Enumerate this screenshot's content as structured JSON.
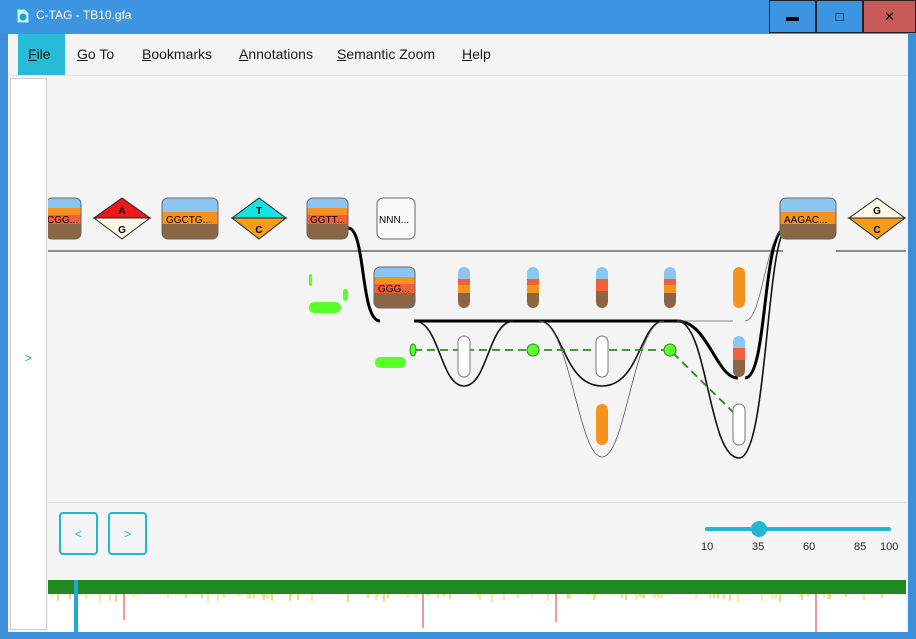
{
  "window": {
    "title": "C-TAG - TB10.gfa",
    "minimize_glyph": "▬",
    "maximize_glyph": "□",
    "close_glyph": "✕"
  },
  "menu": [
    {
      "label": "File",
      "key": "F",
      "rest": "ile",
      "active": true
    },
    {
      "label": "Go To",
      "key": "G",
      "rest": "o To",
      "active": false
    },
    {
      "label": "Bookmarks",
      "key": "B",
      "rest": "ookmarks",
      "active": false
    },
    {
      "label": "Annotations",
      "key": "A",
      "rest": "nnotations",
      "active": false
    },
    {
      "label": "Semantic Zoom",
      "key": "S",
      "rest": "emantic Zoom",
      "active": false
    },
    {
      "label": "Help",
      "key": "H",
      "rest": "elp",
      "active": false
    }
  ],
  "sidebar": {
    "toggle_label": ">"
  },
  "graph": {
    "nodes": [
      {
        "id": "n0",
        "label": "CGG..."
      },
      {
        "id": "n1",
        "label": "GGCTG..."
      },
      {
        "id": "n2",
        "label": "GGTT..."
      },
      {
        "id": "n3",
        "label": "NNN..."
      },
      {
        "id": "n4",
        "label": "GGG..."
      },
      {
        "id": "n5",
        "label": "AAGAC..."
      }
    ],
    "snps": [
      {
        "id": "s0",
        "top": "A",
        "bottom": "G",
        "top_color": "#e81b1b",
        "bottom_color": "#fbf6e8"
      },
      {
        "id": "s1",
        "top": "T",
        "bottom": "C",
        "top_color": "#17e3e3",
        "bottom_color": "#f49d1c"
      },
      {
        "id": "s2",
        "top": "G",
        "bottom": "C",
        "top_color": "#fdf8e9",
        "bottom_color": "#f49d1c"
      }
    ],
    "colors": {
      "blue_band": "#8cc6f0",
      "orange_band": "#f5931e",
      "red_band": "#f0603a",
      "brown_band": "#8b6645",
      "annotation_green": "#5bff2a",
      "path_green": "#2f8a1e"
    }
  },
  "navigation": {
    "prev_label": "<",
    "next_label": ">"
  },
  "zoom": {
    "value": 35,
    "min": 10,
    "max": 100,
    "ticks": [
      "10",
      "35",
      "60",
      "85",
      "100"
    ]
  }
}
